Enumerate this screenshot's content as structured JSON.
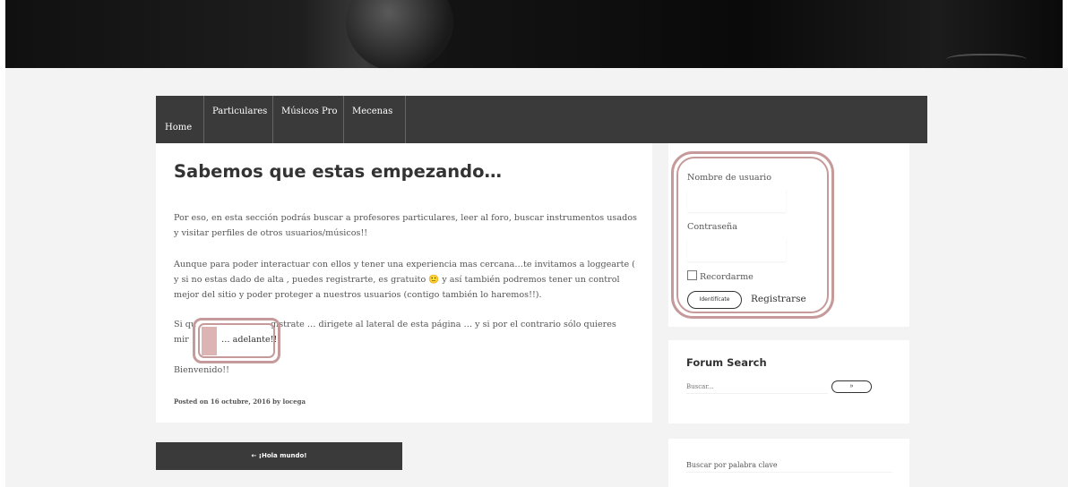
{
  "nav": {
    "items": [
      {
        "label": "Home"
      },
      {
        "label": "Particulares"
      },
      {
        "label": "Músicos Pro"
      },
      {
        "label": "Mecenas"
      }
    ]
  },
  "post": {
    "title": "Sabemos que estas empezando…",
    "paragraph1_line1": "Por eso, en esta sección podrás buscar a profesores particulares, leer al foro, buscar instrumentos usados",
    "paragraph1_line2": "y visitar perfiles de otros usuarios/músicos!!",
    "paragraph2_line1": "Aunque para poder interactuar con ellos y tener una experiencia mas cercana…te invitamos a loggearte (",
    "paragraph2_line2": "y si no estas dado de alta , puedes registrarte, es gratuito 🙂 y así también podremos tener un control",
    "paragraph2_line3": "mejor del sitio y poder proteger a nuestros usuarios (contigo también lo haremos!!).",
    "paragraph3_line1_start": "Si qu",
    "paragraph3_line1_end": "gistrate … dirigete al lateral de esta página … y si por el contrario sólo quieres",
    "paragraph3_line2_start": "mir",
    "adelante_link": "… adelante!!",
    "paragraph4": "Bienvenido!!",
    "posted_meta": "Posted on 16 octubre, 2016 by locega"
  },
  "pagination": {
    "prev_label": "← ¡Hola mundo!"
  },
  "login": {
    "username_label": "Nombre de usuario",
    "password_label": "Contraseña",
    "remember_label": "Recordarme",
    "submit_label": "Identifícate",
    "register_label": "Registrarse"
  },
  "forum_search": {
    "title": "Forum Search",
    "placeholder": "Buscar...",
    "button_label": "»"
  },
  "keyword_search": {
    "label": "Buscar por palabra clave"
  },
  "colors": {
    "nav_bg": "#3a3a3a",
    "highlight": "#c69a9a",
    "page_bg": "#f3f3f3"
  }
}
